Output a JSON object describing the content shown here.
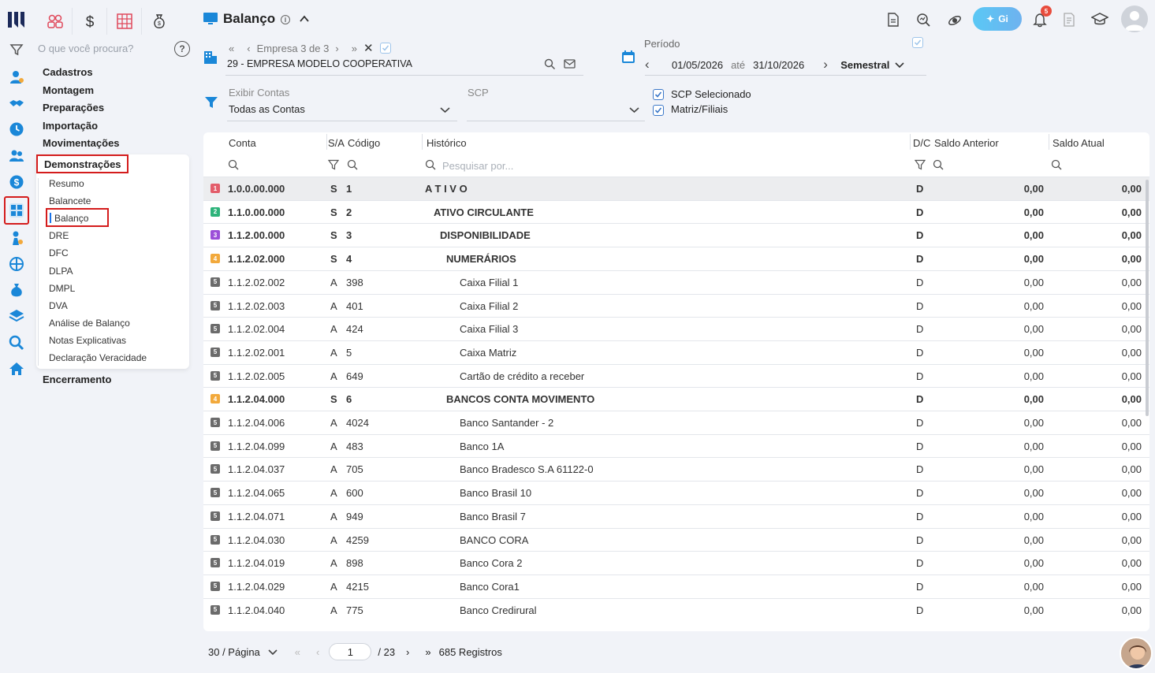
{
  "app": {
    "title": "Balanço"
  },
  "search": {
    "placeholder": "O que você procura?"
  },
  "menu": {
    "items": [
      "Cadastros",
      "Montagem",
      "Preparações",
      "Importação",
      "Movimentações"
    ],
    "active_group": "Demonstrações",
    "subitems": [
      "Resumo",
      "Balancete",
      "Balanço",
      "DRE",
      "DFC",
      "DLPA",
      "DMPL",
      "DVA",
      "Análise de Balanço",
      "Notas Explicativas",
      "Declaração Veracidade"
    ],
    "last": "Encerramento"
  },
  "header": {
    "gi_label": "Gi",
    "notifications": "5"
  },
  "empresa": {
    "nav_label": "Empresa 3 de 3",
    "name": "29 - EMPRESA MODELO COOPERATIVA"
  },
  "periodo": {
    "label": "Período",
    "start": "01/05/2026",
    "ate": "até",
    "end": "31/10/2026",
    "mode": "Semestral"
  },
  "filters": {
    "exibir_label": "Exibir Contas",
    "exibir_value": "Todas as Contas",
    "scp_label": "SCP",
    "scp_value": "",
    "chk_scp": "SCP Selecionado",
    "chk_matriz": "Matriz/Filiais"
  },
  "table": {
    "headers": {
      "conta": "Conta",
      "sa": "S/A",
      "codigo": "Código",
      "historico": "Histórico",
      "dc": "D/C",
      "saldo_anterior": "Saldo Anterior",
      "saldo_atual": "Saldo Atual"
    },
    "search_placeholder": "Pesquisar por...",
    "rows": [
      {
        "lvl": "1",
        "color": "#e35d6a",
        "conta": "1.0.0.00.000",
        "sa": "S",
        "codigo": "1",
        "historico": "A T I V O",
        "indent": 0,
        "dc": "D",
        "ant": "0,00",
        "atual": "0,00",
        "bold": true,
        "sel": true
      },
      {
        "lvl": "2",
        "color": "#2db37a",
        "conta": "1.1.0.00.000",
        "sa": "S",
        "codigo": "2",
        "historico": "ATIVO CIRCULANTE",
        "indent": 11,
        "dc": "D",
        "ant": "0,00",
        "atual": "0,00",
        "bold": true
      },
      {
        "lvl": "3",
        "color": "#9b4fd8",
        "conta": "1.1.2.00.000",
        "sa": "S",
        "codigo": "3",
        "historico": "DISPONIBILIDADE",
        "indent": 19,
        "dc": "D",
        "ant": "0,00",
        "atual": "0,00",
        "bold": true
      },
      {
        "lvl": "4",
        "color": "#f2a93b",
        "conta": "1.1.2.02.000",
        "sa": "S",
        "codigo": "4",
        "historico": "NUMERÁRIOS",
        "indent": 27,
        "dc": "D",
        "ant": "0,00",
        "atual": "0,00",
        "bold": true
      },
      {
        "lvl": "5",
        "color": "#6b6b6b",
        "conta": "1.1.2.02.002",
        "sa": "A",
        "codigo": "398",
        "historico": "Caixa Filial 1",
        "indent": 44,
        "dc": "D",
        "ant": "0,00",
        "atual": "0,00"
      },
      {
        "lvl": "5",
        "color": "#6b6b6b",
        "conta": "1.1.2.02.003",
        "sa": "A",
        "codigo": "401",
        "historico": "Caixa Filial 2",
        "indent": 44,
        "dc": "D",
        "ant": "0,00",
        "atual": "0,00"
      },
      {
        "lvl": "5",
        "color": "#6b6b6b",
        "conta": "1.1.2.02.004",
        "sa": "A",
        "codigo": "424",
        "historico": "Caixa Filial 3",
        "indent": 44,
        "dc": "D",
        "ant": "0,00",
        "atual": "0,00"
      },
      {
        "lvl": "5",
        "color": "#6b6b6b",
        "conta": "1.1.2.02.001",
        "sa": "A",
        "codigo": "5",
        "historico": "Caixa Matriz",
        "indent": 44,
        "dc": "D",
        "ant": "0,00",
        "atual": "0,00"
      },
      {
        "lvl": "5",
        "color": "#6b6b6b",
        "conta": "1.1.2.02.005",
        "sa": "A",
        "codigo": "649",
        "historico": "Cartão de crédito a receber",
        "indent": 44,
        "dc": "D",
        "ant": "0,00",
        "atual": "0,00"
      },
      {
        "lvl": "4",
        "color": "#f2a93b",
        "conta": "1.1.2.04.000",
        "sa": "S",
        "codigo": "6",
        "historico": "BANCOS CONTA MOVIMENTO",
        "indent": 27,
        "dc": "D",
        "ant": "0,00",
        "atual": "0,00",
        "bold": true
      },
      {
        "lvl": "5",
        "color": "#6b6b6b",
        "conta": "1.1.2.04.006",
        "sa": "A",
        "codigo": "4024",
        "historico": "Banco Santander - 2",
        "indent": 44,
        "dc": "D",
        "ant": "0,00",
        "atual": "0,00"
      },
      {
        "lvl": "5",
        "color": "#6b6b6b",
        "conta": "1.1.2.04.099",
        "sa": "A",
        "codigo": "483",
        "historico": "Banco 1A",
        "indent": 44,
        "dc": "D",
        "ant": "0,00",
        "atual": "0,00"
      },
      {
        "lvl": "5",
        "color": "#6b6b6b",
        "conta": "1.1.2.04.037",
        "sa": "A",
        "codigo": "705",
        "historico": "Banco Bradesco S.A 61122-0",
        "indent": 44,
        "dc": "D",
        "ant": "0,00",
        "atual": "0,00"
      },
      {
        "lvl": "5",
        "color": "#6b6b6b",
        "conta": "1.1.2.04.065",
        "sa": "A",
        "codigo": "600",
        "historico": "Banco Brasil 10",
        "indent": 44,
        "dc": "D",
        "ant": "0,00",
        "atual": "0,00"
      },
      {
        "lvl": "5",
        "color": "#6b6b6b",
        "conta": "1.1.2.04.071",
        "sa": "A",
        "codigo": "949",
        "historico": "Banco Brasil 7",
        "indent": 44,
        "dc": "D",
        "ant": "0,00",
        "atual": "0,00"
      },
      {
        "lvl": "5",
        "color": "#6b6b6b",
        "conta": "1.1.2.04.030",
        "sa": "A",
        "codigo": "4259",
        "historico": "BANCO CORA",
        "indent": 44,
        "dc": "D",
        "ant": "0,00",
        "atual": "0,00"
      },
      {
        "lvl": "5",
        "color": "#6b6b6b",
        "conta": "1.1.2.04.019",
        "sa": "A",
        "codigo": "898",
        "historico": "Banco Cora 2",
        "indent": 44,
        "dc": "D",
        "ant": "0,00",
        "atual": "0,00"
      },
      {
        "lvl": "5",
        "color": "#6b6b6b",
        "conta": "1.1.2.04.029",
        "sa": "A",
        "codigo": "4215",
        "historico": "Banco Cora1",
        "indent": 44,
        "dc": "D",
        "ant": "0,00",
        "atual": "0,00"
      },
      {
        "lvl": "5",
        "color": "#6b6b6b",
        "conta": "1.1.2.04.040",
        "sa": "A",
        "codigo": "775",
        "historico": "Banco Credirural",
        "indent": 44,
        "dc": "D",
        "ant": "0,00",
        "atual": "0,00"
      }
    ]
  },
  "pager": {
    "per_page": "30 / Página",
    "page": "1",
    "total_pages": "/ 23",
    "records": "685 Registros"
  }
}
